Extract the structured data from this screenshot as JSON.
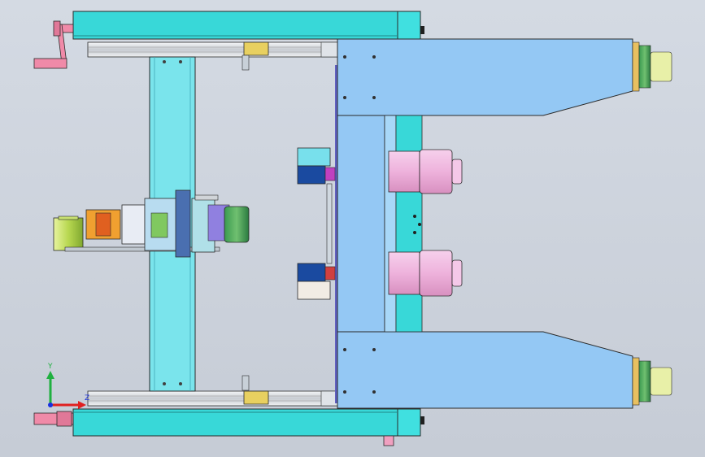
{
  "viewport": {
    "background_top": "#d4dae3",
    "background_bottom": "#c6ccd6"
  },
  "triad": {
    "y_label": "Y",
    "z_label": "Z",
    "x_color": "#e02020",
    "y_color": "#20b040",
    "z_color": "#1830e0"
  },
  "colors": {
    "frame_cyan": "#38d8d8",
    "column_cyan": "#7ae4ec",
    "plate_blue": "#94c8f4",
    "motor_pink": "#f0b8e0",
    "handle_pink": "#f08aa8",
    "roller_green": "#88c040",
    "rail_grey": "#d8dce0",
    "outline": "#2a2a2a"
  }
}
